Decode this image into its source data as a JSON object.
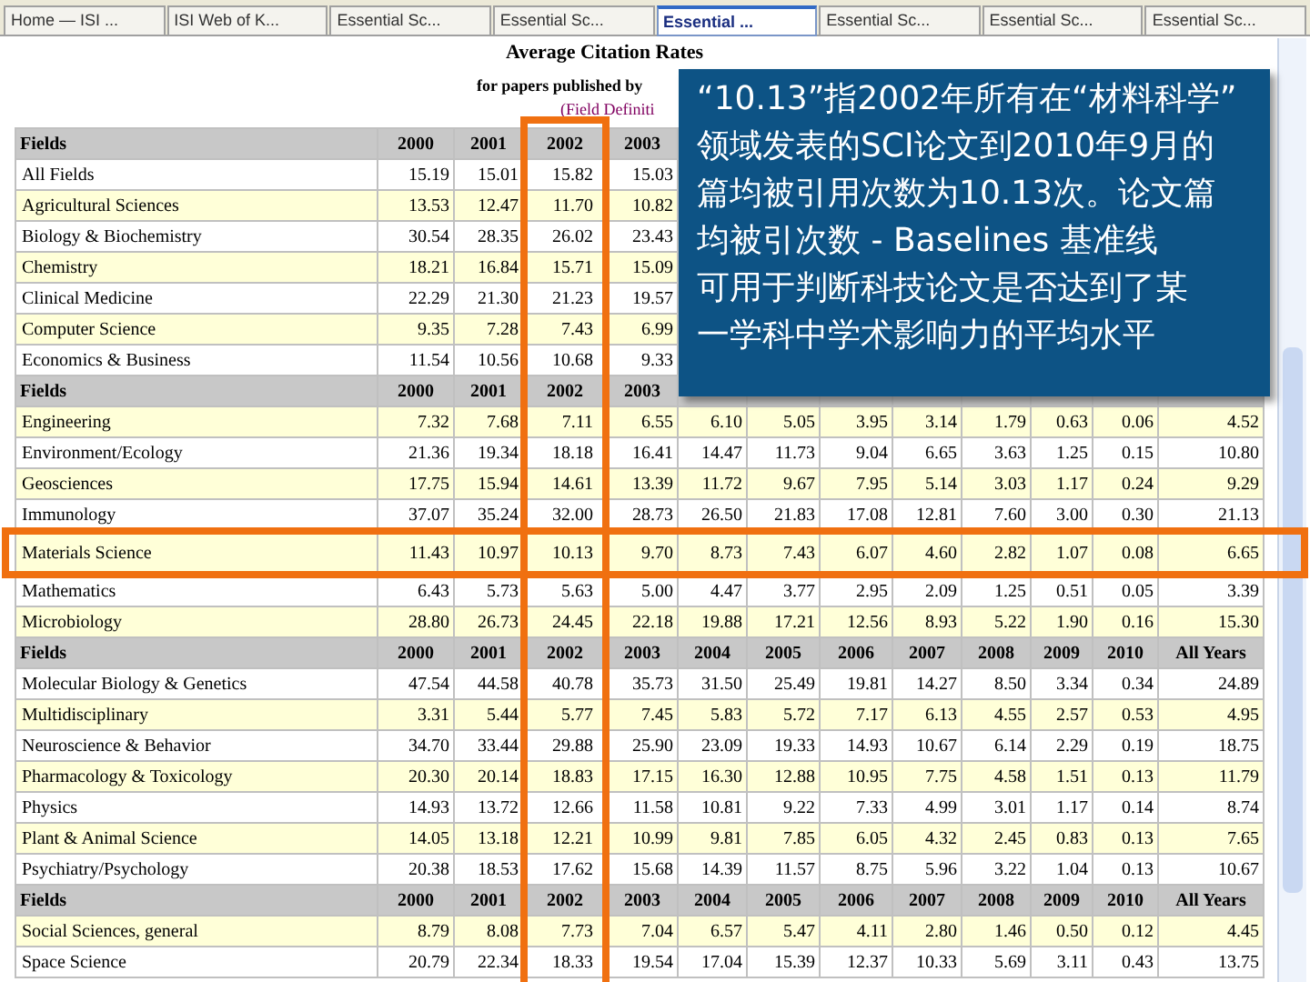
{
  "browser": {
    "tabs": [
      {
        "label": "Home — ISI ...",
        "selected": false
      },
      {
        "label": "ISI Web of K...",
        "selected": false
      },
      {
        "label": "Essential Sc...",
        "selected": false
      },
      {
        "label": "Essential Sc...",
        "selected": false
      },
      {
        "label": "Essential ...",
        "selected": true
      },
      {
        "label": "Essential Sc...",
        "selected": false
      },
      {
        "label": "Essential Sc...",
        "selected": false
      },
      {
        "label": "Essential Sc...",
        "selected": false
      }
    ]
  },
  "page": {
    "title": "Average Citation Rates",
    "subtitle": "for papers published by",
    "link": "(Field Definiti"
  },
  "table": {
    "sections": [
      {
        "header": [
          "Fields",
          "2000",
          "2001",
          "2002",
          "2003"
        ],
        "rows": [
          {
            "field": "All Fields",
            "values": [
              "15.19",
              "15.01",
              "15.82",
              "15.03"
            ]
          },
          {
            "field": "Agricultural Sciences",
            "values": [
              "13.53",
              "12.47",
              "11.70",
              "10.82"
            ]
          },
          {
            "field": "Biology & Biochemistry",
            "values": [
              "30.54",
              "28.35",
              "26.02",
              "23.43"
            ]
          },
          {
            "field": "Chemistry",
            "values": [
              "18.21",
              "16.84",
              "15.71",
              "15.09"
            ]
          },
          {
            "field": "Clinical Medicine",
            "values": [
              "22.29",
              "21.30",
              "21.23",
              "19.57"
            ]
          },
          {
            "field": "Computer Science",
            "values": [
              "9.35",
              "7.28",
              "7.43",
              "6.99"
            ]
          },
          {
            "field": "Economics & Business",
            "values": [
              "11.54",
              "10.56",
              "10.68",
              "9.33"
            ]
          }
        ]
      },
      {
        "header": [
          "Fields",
          "2000",
          "2001",
          "2002",
          "2003"
        ],
        "rows": [
          {
            "field": "Engineering",
            "values": [
              "7.32",
              "7.68",
              "7.11",
              "6.55",
              "6.10",
              "5.05",
              "3.95",
              "3.14",
              "1.79",
              "0.63",
              "0.06",
              "4.52"
            ]
          },
          {
            "field": "Environment/Ecology",
            "values": [
              "21.36",
              "19.34",
              "18.18",
              "16.41",
              "14.47",
              "11.73",
              "9.04",
              "6.65",
              "3.63",
              "1.25",
              "0.15",
              "10.80"
            ]
          },
          {
            "field": "Geosciences",
            "values": [
              "17.75",
              "15.94",
              "14.61",
              "13.39",
              "11.72",
              "9.67",
              "7.95",
              "5.14",
              "3.03",
              "1.17",
              "0.24",
              "9.29"
            ]
          },
          {
            "field": "Immunology",
            "values": [
              "37.07",
              "35.24",
              "32.00",
              "28.73",
              "26.50",
              "21.83",
              "17.08",
              "12.81",
              "7.60",
              "3.00",
              "0.30",
              "21.13"
            ]
          },
          {
            "field": "Materials Science",
            "highlighted": true,
            "values": [
              "11.43",
              "10.97",
              "10.13",
              "9.70",
              "8.73",
              "7.43",
              "6.07",
              "4.60",
              "2.82",
              "1.07",
              "0.08",
              "6.65"
            ]
          },
          {
            "field": "Mathematics",
            "values": [
              "6.43",
              "5.73",
              "5.63",
              "5.00",
              "4.47",
              "3.77",
              "2.95",
              "2.09",
              "1.25",
              "0.51",
              "0.05",
              "3.39"
            ]
          },
          {
            "field": "Microbiology",
            "values": [
              "28.80",
              "26.73",
              "24.45",
              "22.18",
              "19.88",
              "17.21",
              "12.56",
              "8.93",
              "5.22",
              "1.90",
              "0.16",
              "15.30"
            ]
          }
        ]
      },
      {
        "header": [
          "Fields",
          "2000",
          "2001",
          "2002",
          "2003",
          "2004",
          "2005",
          "2006",
          "2007",
          "2008",
          "2009",
          "2010",
          "All Years"
        ],
        "rows": [
          {
            "field": "Molecular Biology & Genetics",
            "values": [
              "47.54",
              "44.58",
              "40.78",
              "35.73",
              "31.50",
              "25.49",
              "19.81",
              "14.27",
              "8.50",
              "3.34",
              "0.34",
              "24.89"
            ]
          },
          {
            "field": "Multidisciplinary",
            "values": [
              "3.31",
              "5.44",
              "5.77",
              "7.45",
              "5.83",
              "5.72",
              "7.17",
              "6.13",
              "4.55",
              "2.57",
              "0.53",
              "4.95"
            ]
          },
          {
            "field": "Neuroscience & Behavior",
            "values": [
              "34.70",
              "33.44",
              "29.88",
              "25.90",
              "23.09",
              "19.33",
              "14.93",
              "10.67",
              "6.14",
              "2.29",
              "0.19",
              "18.75"
            ]
          },
          {
            "field": "Pharmacology & Toxicology",
            "values": [
              "20.30",
              "20.14",
              "18.83",
              "17.15",
              "16.30",
              "12.88",
              "10.95",
              "7.75",
              "4.58",
              "1.51",
              "0.13",
              "11.79"
            ]
          },
          {
            "field": "Physics",
            "values": [
              "14.93",
              "13.72",
              "12.66",
              "11.58",
              "10.81",
              "9.22",
              "7.33",
              "4.99",
              "3.01",
              "1.17",
              "0.14",
              "8.74"
            ]
          },
          {
            "field": "Plant & Animal Science",
            "values": [
              "14.05",
              "13.18",
              "12.21",
              "10.99",
              "9.81",
              "7.85",
              "6.05",
              "4.32",
              "2.45",
              "0.83",
              "0.13",
              "7.65"
            ]
          },
          {
            "field": "Psychiatry/Psychology",
            "values": [
              "20.38",
              "18.53",
              "17.62",
              "15.68",
              "14.39",
              "11.57",
              "8.75",
              "5.96",
              "3.22",
              "1.04",
              "0.13",
              "10.67"
            ]
          }
        ]
      },
      {
        "header": [
          "Fields",
          "2000",
          "2001",
          "2002",
          "2003",
          "2004",
          "2005",
          "2006",
          "2007",
          "2008",
          "2009",
          "2010",
          "All Years"
        ],
        "rows": [
          {
            "field": "Social Sciences, general",
            "values": [
              "8.79",
              "8.08",
              "7.73",
              "7.04",
              "6.57",
              "5.47",
              "4.11",
              "2.80",
              "1.46",
              "0.50",
              "0.12",
              "4.45"
            ]
          },
          {
            "field": "Space Science",
            "values": [
              "20.79",
              "22.34",
              "18.33",
              "19.54",
              "17.04",
              "15.39",
              "12.37",
              "10.33",
              "5.69",
              "3.11",
              "0.43",
              "13.75"
            ]
          }
        ]
      }
    ]
  },
  "callout": {
    "lines": [
      "“10.13”指2002年所有在“材料科学”",
      "领域发表的SCI论文到2010年9月的",
      "篇均被引用次数为10.13次。论文篇",
      "均被引次数 - Baselines 基准线",
      "可用于判断科技论文是否达到了某",
      "一学科中学术影响力的平均水平"
    ]
  }
}
